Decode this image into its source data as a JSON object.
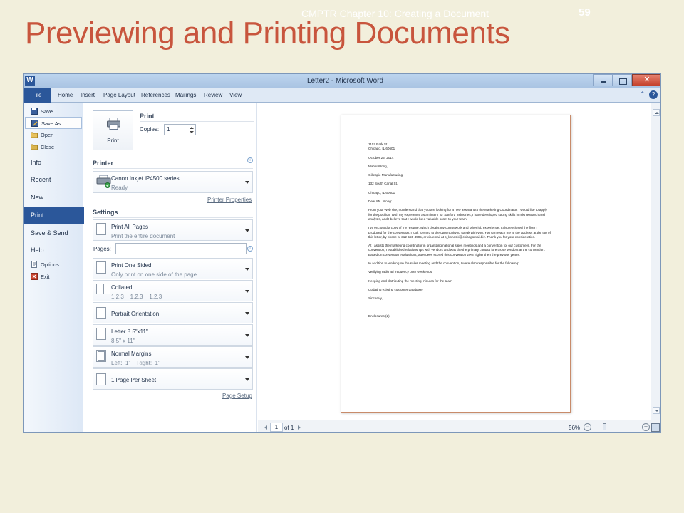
{
  "slide": {
    "header": "CMPTR Chapter 10: Creating a Document",
    "number": "59",
    "title": "Previewing and Printing Documents"
  },
  "window": {
    "title": "Letter2  -  Microsoft Word",
    "close_glyph": "✕"
  },
  "ribbon": {
    "file": "File",
    "tabs": [
      "Home",
      "Insert",
      "Page Layout",
      "References",
      "Mailings",
      "Review",
      "View"
    ]
  },
  "backstage": {
    "small_items": [
      "Save",
      "Save As",
      "Open",
      "Close"
    ],
    "big_items": [
      "Info",
      "Recent",
      "New",
      "Print",
      "Save & Send",
      "Help"
    ],
    "bottom_items": [
      "Options",
      "Exit"
    ]
  },
  "print_panel": {
    "section_title": "Print",
    "print_button_label": "Print",
    "copies_label": "Copies:",
    "copies_value": "1",
    "printer_title": "Printer",
    "printer_name": "Canon Inkjet iP4500 series",
    "printer_status": "Ready",
    "printer_properties_link": "Printer Properties",
    "settings_title": "Settings",
    "pages_label": "Pages:",
    "pages_value": "",
    "options": [
      {
        "line1": "Print All Pages",
        "line2": "Print the entire document"
      },
      {
        "line1": "Print One Sided",
        "line2": "Only print on one side of the page"
      },
      {
        "line1": "Collated",
        "line2": "1,2,3    1,2,3    1,2,3"
      },
      {
        "line1": "Portrait Orientation",
        "line2": ""
      },
      {
        "line1": "Letter 8.5\"x11\"",
        "line2": "8.5\" x 11\""
      },
      {
        "line1": "Normal Margins",
        "line2": "Left:  1\"    Right:  1\""
      },
      {
        "line1": "1 Page Per Sheet",
        "line2": ""
      }
    ],
    "page_setup_link": "Page Setup"
  },
  "letter": {
    "address1": "1107 Park St.",
    "address2": "Chicago, IL 60601",
    "date": "October 25, 2014",
    "recipient": "Mabel Wong,",
    "company": "Gillespie Manufacturing",
    "street": "132 South Canal St.",
    "city": "Chicago, IL 60601",
    "salutation": "Dear Ms. Wong:",
    "para1": "From your Web site, I understand that you are looking for a new assistant to the Marketing Coordinator. I would like to apply for the position. With my experience as an intern for Sanford Industries, I have developed strong skills in mkt research and analysis, and I believe that I would be a valuable asset to your team.",
    "para2": "I've enclosed a copy of my résumé, which details my coursework and other job experience. I also enclosed the flyer I produced for the convention. I look forward to the opportunity to speak with you. You can reach me at the address at the top of this letter, by phone at 312-555-4995, or via email at s_konoski@chicagomail.biz. Thank you for your consideration.",
    "para3": "At I assists the marketing coordinator in organizing national sales meetings and a convention for our customers. For the convention, I established relationships with vendors and was the the primary contact fore those vendors at the convention. Based on convention evaluations, attendees scored this convention 20% higher then the previous year's.",
    "para4": "In addition to working on the sales meeting and the convention, I were also responsible for the following:",
    "item1": "Verifying radio ad frequency over weekends",
    "item2": "Keeping and distributing the meeting minutes for the team",
    "item3": "Updating existing customer database",
    "closing": "Sincerely,",
    "enclosures": "Enclosures  (2)"
  },
  "status": {
    "page_current": "1",
    "page_of": "of 1",
    "zoom": "56%",
    "zoom_level_percent": 56
  }
}
